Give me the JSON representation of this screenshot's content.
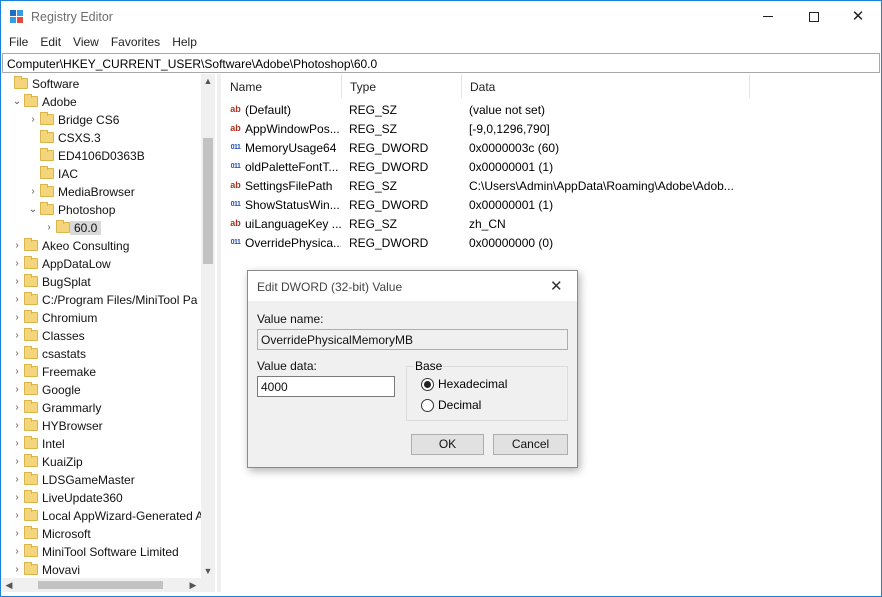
{
  "window": {
    "title": "Registry Editor"
  },
  "menu": [
    "File",
    "Edit",
    "View",
    "Favorites",
    "Help"
  ],
  "address": "Computer\\HKEY_CURRENT_USER\\Software\\Adobe\\Photoshop\\60.0",
  "tree": [
    {
      "label": "Software",
      "arrow": "",
      "level": 0
    },
    {
      "label": "Adobe",
      "arrow": "⌄",
      "level": 1
    },
    {
      "label": "Bridge CS6",
      "arrow": "›",
      "level": 2
    },
    {
      "label": "CSXS.3",
      "arrow": "",
      "level": 2
    },
    {
      "label": "ED4106D0363B",
      "arrow": "",
      "level": 2
    },
    {
      "label": "IAC",
      "arrow": "",
      "level": 2
    },
    {
      "label": "MediaBrowser",
      "arrow": "›",
      "level": 2
    },
    {
      "label": "Photoshop",
      "arrow": "⌄",
      "level": 2
    },
    {
      "label": "60.0",
      "arrow": "›",
      "level": 3,
      "selected": true
    },
    {
      "label": "Akeo Consulting",
      "arrow": "›",
      "level": 1
    },
    {
      "label": "AppDataLow",
      "arrow": "›",
      "level": 1
    },
    {
      "label": "BugSplat",
      "arrow": "›",
      "level": 1
    },
    {
      "label": "C:/Program Files/MiniTool Pa",
      "arrow": "›",
      "level": 1
    },
    {
      "label": "Chromium",
      "arrow": "›",
      "level": 1
    },
    {
      "label": "Classes",
      "arrow": "›",
      "level": 1
    },
    {
      "label": "csastats",
      "arrow": "›",
      "level": 1
    },
    {
      "label": "Freemake",
      "arrow": "›",
      "level": 1
    },
    {
      "label": "Google",
      "arrow": "›",
      "level": 1
    },
    {
      "label": "Grammarly",
      "arrow": "›",
      "level": 1
    },
    {
      "label": "HYBrowser",
      "arrow": "›",
      "level": 1
    },
    {
      "label": "Intel",
      "arrow": "›",
      "level": 1
    },
    {
      "label": "KuaiZip",
      "arrow": "›",
      "level": 1
    },
    {
      "label": "LDSGameMaster",
      "arrow": "›",
      "level": 1
    },
    {
      "label": "LiveUpdate360",
      "arrow": "›",
      "level": 1
    },
    {
      "label": "Local AppWizard-Generated A",
      "arrow": "›",
      "level": 1
    },
    {
      "label": "Microsoft",
      "arrow": "›",
      "level": 1
    },
    {
      "label": "MiniTool Software Limited",
      "arrow": "›",
      "level": 1
    },
    {
      "label": "Movavi",
      "arrow": "›",
      "level": 1
    }
  ],
  "columns": {
    "name": "Name",
    "type": "Type",
    "data": "Data"
  },
  "values": [
    {
      "kind": "sz",
      "name": "(Default)",
      "type": "REG_SZ",
      "data": "(value not set)"
    },
    {
      "kind": "sz",
      "name": "AppWindowPos...",
      "type": "REG_SZ",
      "data": "[-9,0,1296,790]"
    },
    {
      "kind": "dword",
      "name": "MemoryUsage64",
      "type": "REG_DWORD",
      "data": "0x0000003c (60)"
    },
    {
      "kind": "dword",
      "name": "oldPaletteFontT...",
      "type": "REG_DWORD",
      "data": "0x00000001 (1)"
    },
    {
      "kind": "sz",
      "name": "SettingsFilePath",
      "type": "REG_SZ",
      "data": "C:\\Users\\Admin\\AppData\\Roaming\\Adobe\\Adob..."
    },
    {
      "kind": "dword",
      "name": "ShowStatusWin...",
      "type": "REG_DWORD",
      "data": "0x00000001 (1)"
    },
    {
      "kind": "sz",
      "name": "uiLanguageKey ...",
      "type": "REG_SZ",
      "data": "zh_CN"
    },
    {
      "kind": "dword",
      "name": "OverridePhysica...",
      "type": "REG_DWORD",
      "data": "0x00000000 (0)"
    }
  ],
  "icon_text": {
    "sz": "ab",
    "dword": "011"
  },
  "dialog": {
    "title": "Edit DWORD (32-bit) Value",
    "value_name_label": "Value name:",
    "value_name": "OverridePhysicalMemoryMB",
    "value_data_label": "Value data:",
    "value_data": "4000",
    "base_label": "Base",
    "hex_label": "Hexadecimal",
    "dec_label": "Decimal",
    "base_selected": "Hexadecimal",
    "ok": "OK",
    "cancel": "Cancel"
  },
  "colors": {
    "window_border": "#1883d7",
    "folder": "#f5d57b",
    "selection": "#d9d9d9"
  }
}
